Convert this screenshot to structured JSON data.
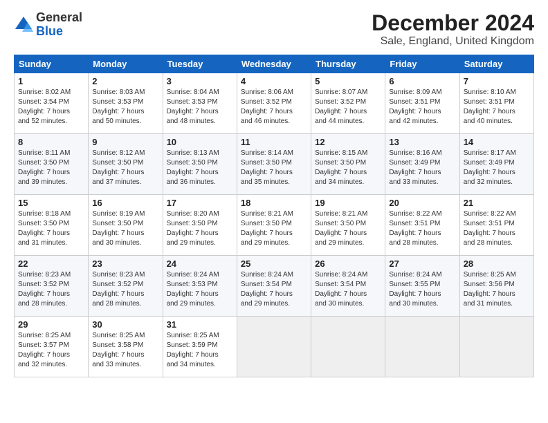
{
  "logo": {
    "general": "General",
    "blue": "Blue"
  },
  "header": {
    "month": "December 2024",
    "location": "Sale, England, United Kingdom"
  },
  "weekdays": [
    "Sunday",
    "Monday",
    "Tuesday",
    "Wednesday",
    "Thursday",
    "Friday",
    "Saturday"
  ],
  "weeks": [
    [
      {
        "day": "1",
        "sunrise": "Sunrise: 8:02 AM",
        "sunset": "Sunset: 3:54 PM",
        "daylight": "Daylight: 7 hours and 52 minutes."
      },
      {
        "day": "2",
        "sunrise": "Sunrise: 8:03 AM",
        "sunset": "Sunset: 3:53 PM",
        "daylight": "Daylight: 7 hours and 50 minutes."
      },
      {
        "day": "3",
        "sunrise": "Sunrise: 8:04 AM",
        "sunset": "Sunset: 3:53 PM",
        "daylight": "Daylight: 7 hours and 48 minutes."
      },
      {
        "day": "4",
        "sunrise": "Sunrise: 8:06 AM",
        "sunset": "Sunset: 3:52 PM",
        "daylight": "Daylight: 7 hours and 46 minutes."
      },
      {
        "day": "5",
        "sunrise": "Sunrise: 8:07 AM",
        "sunset": "Sunset: 3:52 PM",
        "daylight": "Daylight: 7 hours and 44 minutes."
      },
      {
        "day": "6",
        "sunrise": "Sunrise: 8:09 AM",
        "sunset": "Sunset: 3:51 PM",
        "daylight": "Daylight: 7 hours and 42 minutes."
      },
      {
        "day": "7",
        "sunrise": "Sunrise: 8:10 AM",
        "sunset": "Sunset: 3:51 PM",
        "daylight": "Daylight: 7 hours and 40 minutes."
      }
    ],
    [
      {
        "day": "8",
        "sunrise": "Sunrise: 8:11 AM",
        "sunset": "Sunset: 3:50 PM",
        "daylight": "Daylight: 7 hours and 39 minutes."
      },
      {
        "day": "9",
        "sunrise": "Sunrise: 8:12 AM",
        "sunset": "Sunset: 3:50 PM",
        "daylight": "Daylight: 7 hours and 37 minutes."
      },
      {
        "day": "10",
        "sunrise": "Sunrise: 8:13 AM",
        "sunset": "Sunset: 3:50 PM",
        "daylight": "Daylight: 7 hours and 36 minutes."
      },
      {
        "day": "11",
        "sunrise": "Sunrise: 8:14 AM",
        "sunset": "Sunset: 3:50 PM",
        "daylight": "Daylight: 7 hours and 35 minutes."
      },
      {
        "day": "12",
        "sunrise": "Sunrise: 8:15 AM",
        "sunset": "Sunset: 3:50 PM",
        "daylight": "Daylight: 7 hours and 34 minutes."
      },
      {
        "day": "13",
        "sunrise": "Sunrise: 8:16 AM",
        "sunset": "Sunset: 3:49 PM",
        "daylight": "Daylight: 7 hours and 33 minutes."
      },
      {
        "day": "14",
        "sunrise": "Sunrise: 8:17 AM",
        "sunset": "Sunset: 3:49 PM",
        "daylight": "Daylight: 7 hours and 32 minutes."
      }
    ],
    [
      {
        "day": "15",
        "sunrise": "Sunrise: 8:18 AM",
        "sunset": "Sunset: 3:50 PM",
        "daylight": "Daylight: 7 hours and 31 minutes."
      },
      {
        "day": "16",
        "sunrise": "Sunrise: 8:19 AM",
        "sunset": "Sunset: 3:50 PM",
        "daylight": "Daylight: 7 hours and 30 minutes."
      },
      {
        "day": "17",
        "sunrise": "Sunrise: 8:20 AM",
        "sunset": "Sunset: 3:50 PM",
        "daylight": "Daylight: 7 hours and 29 minutes."
      },
      {
        "day": "18",
        "sunrise": "Sunrise: 8:21 AM",
        "sunset": "Sunset: 3:50 PM",
        "daylight": "Daylight: 7 hours and 29 minutes."
      },
      {
        "day": "19",
        "sunrise": "Sunrise: 8:21 AM",
        "sunset": "Sunset: 3:50 PM",
        "daylight": "Daylight: 7 hours and 29 minutes."
      },
      {
        "day": "20",
        "sunrise": "Sunrise: 8:22 AM",
        "sunset": "Sunset: 3:51 PM",
        "daylight": "Daylight: 7 hours and 28 minutes."
      },
      {
        "day": "21",
        "sunrise": "Sunrise: 8:22 AM",
        "sunset": "Sunset: 3:51 PM",
        "daylight": "Daylight: 7 hours and 28 minutes."
      }
    ],
    [
      {
        "day": "22",
        "sunrise": "Sunrise: 8:23 AM",
        "sunset": "Sunset: 3:52 PM",
        "daylight": "Daylight: 7 hours and 28 minutes."
      },
      {
        "day": "23",
        "sunrise": "Sunrise: 8:23 AM",
        "sunset": "Sunset: 3:52 PM",
        "daylight": "Daylight: 7 hours and 28 minutes."
      },
      {
        "day": "24",
        "sunrise": "Sunrise: 8:24 AM",
        "sunset": "Sunset: 3:53 PM",
        "daylight": "Daylight: 7 hours and 29 minutes."
      },
      {
        "day": "25",
        "sunrise": "Sunrise: 8:24 AM",
        "sunset": "Sunset: 3:54 PM",
        "daylight": "Daylight: 7 hours and 29 minutes."
      },
      {
        "day": "26",
        "sunrise": "Sunrise: 8:24 AM",
        "sunset": "Sunset: 3:54 PM",
        "daylight": "Daylight: 7 hours and 30 minutes."
      },
      {
        "day": "27",
        "sunrise": "Sunrise: 8:24 AM",
        "sunset": "Sunset: 3:55 PM",
        "daylight": "Daylight: 7 hours and 30 minutes."
      },
      {
        "day": "28",
        "sunrise": "Sunrise: 8:25 AM",
        "sunset": "Sunset: 3:56 PM",
        "daylight": "Daylight: 7 hours and 31 minutes."
      }
    ],
    [
      {
        "day": "29",
        "sunrise": "Sunrise: 8:25 AM",
        "sunset": "Sunset: 3:57 PM",
        "daylight": "Daylight: 7 hours and 32 minutes."
      },
      {
        "day": "30",
        "sunrise": "Sunrise: 8:25 AM",
        "sunset": "Sunset: 3:58 PM",
        "daylight": "Daylight: 7 hours and 33 minutes."
      },
      {
        "day": "31",
        "sunrise": "Sunrise: 8:25 AM",
        "sunset": "Sunset: 3:59 PM",
        "daylight": "Daylight: 7 hours and 34 minutes."
      },
      null,
      null,
      null,
      null
    ]
  ]
}
